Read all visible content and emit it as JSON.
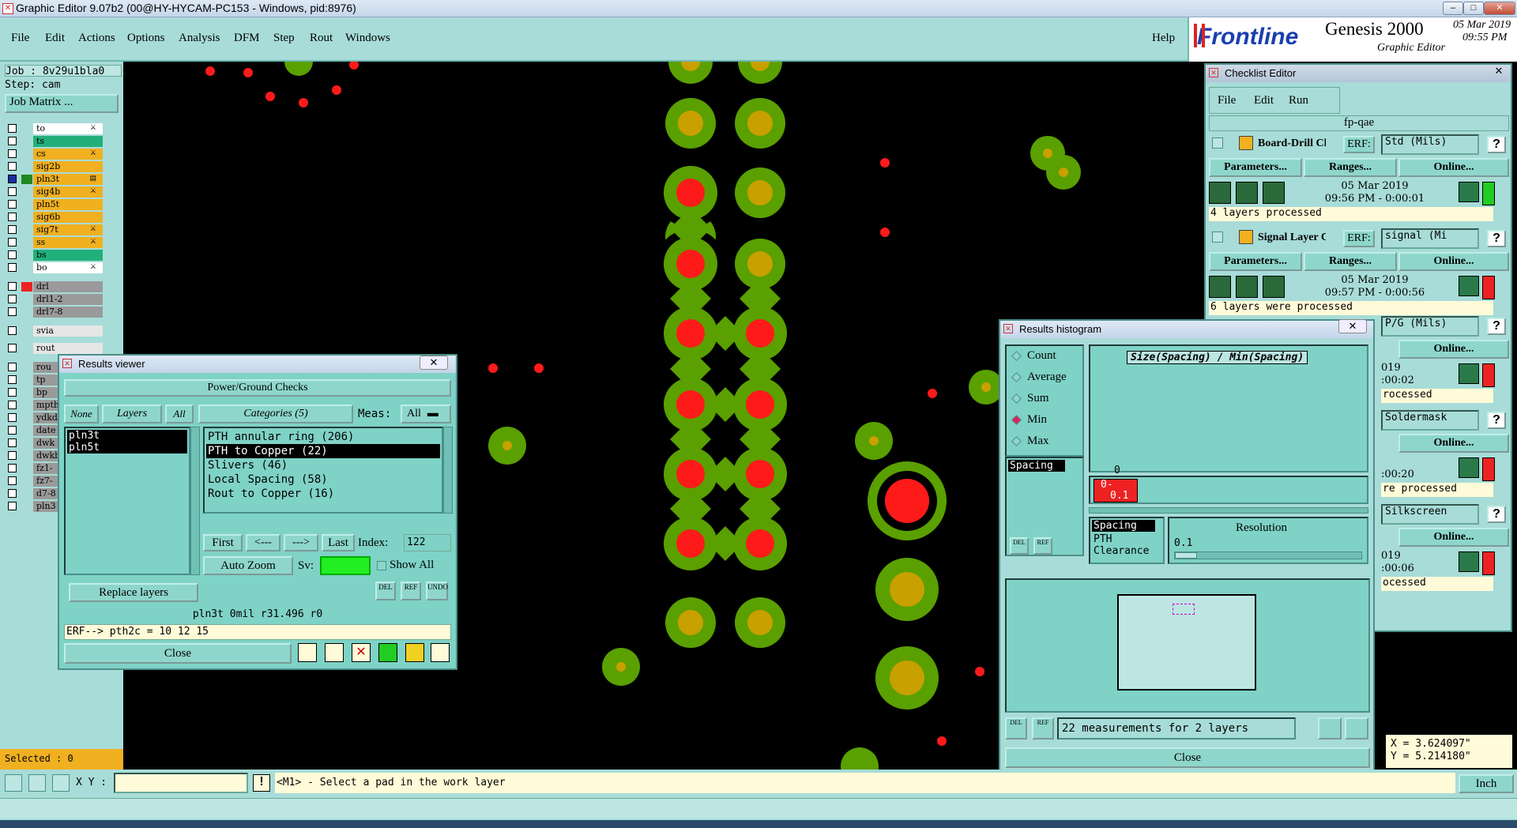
{
  "window": {
    "title": "Graphic Editor 9.07b2 (00@HY-HYCAM-PC153 - Windows, pid:8976)"
  },
  "menu": {
    "items": [
      "File",
      "Edit",
      "Actions",
      "Options",
      "Analysis",
      "DFM",
      "Step",
      "Rout",
      "Windows"
    ],
    "help": "Help"
  },
  "branding": {
    "logo_text": "Frontline",
    "product": "Genesis 2000",
    "subtitle": "Graphic Editor",
    "date": "05 Mar 2019",
    "time": "09:55 PM"
  },
  "left_panel": {
    "job": "Job : 8v29u1bla0",
    "step": "Step: cam",
    "job_matrix_button": "Job Matrix ...",
    "layers": [
      {
        "name": "to",
        "color": "#ffffff",
        "mark": "⚔"
      },
      {
        "name": "ts",
        "color": "#22b07a",
        "mark": ""
      },
      {
        "name": "cs",
        "color": "#f0b020",
        "mark": "⚔"
      },
      {
        "name": "sig2b",
        "color": "#f0b020",
        "mark": ""
      },
      {
        "name": "pln3t",
        "color": "#f0b020",
        "mark": "▤"
      },
      {
        "name": "sig4b",
        "color": "#f0b020",
        "mark": "⚔"
      },
      {
        "name": "pln5t",
        "color": "#f0b020",
        "mark": ""
      },
      {
        "name": "sig6b",
        "color": "#f0b020",
        "mark": ""
      },
      {
        "name": "sig7t",
        "color": "#f0b020",
        "mark": "⚔"
      },
      {
        "name": "ss",
        "color": "#f0b020",
        "mark": "⚔"
      },
      {
        "name": "bs",
        "color": "#22b07a",
        "mark": ""
      },
      {
        "name": "bo",
        "color": "#ffffff",
        "mark": "⚔"
      },
      {
        "name": "drl",
        "color": "#9a9a9a",
        "mark": ""
      },
      {
        "name": "drl1-2",
        "color": "#9a9a9a",
        "mark": ""
      },
      {
        "name": "drl7-8",
        "color": "#9a9a9a",
        "mark": ""
      },
      {
        "name": "svia",
        "color": "#e6e6e6",
        "mark": ""
      },
      {
        "name": "rout",
        "color": "#e6e6e6",
        "mark": ""
      },
      {
        "name": "rou",
        "color": "#9a9a9a",
        "mark": ""
      },
      {
        "name": "tp",
        "color": "#9a9a9a",
        "mark": ""
      },
      {
        "name": "bp",
        "color": "#9a9a9a",
        "mark": ""
      },
      {
        "name": "mpth",
        "color": "#9a9a9a",
        "mark": ""
      },
      {
        "name": "ydkd",
        "color": "#9a9a9a",
        "mark": ""
      },
      {
        "name": "date",
        "color": "#9a9a9a",
        "mark": ""
      },
      {
        "name": "dwk",
        "color": "#9a9a9a",
        "mark": ""
      },
      {
        "name": "dwkb",
        "color": "#9a9a9a",
        "mark": ""
      },
      {
        "name": "fz1-",
        "color": "#9a9a9a",
        "mark": ""
      },
      {
        "name": "fz7-",
        "color": "#9a9a9a",
        "mark": ""
      },
      {
        "name": "d7-8",
        "color": "#9a9a9a",
        "mark": ""
      },
      {
        "name": "pln3",
        "color": "#9a9a9a",
        "mark": ""
      }
    ],
    "selected": "Selected : 0"
  },
  "results_viewer": {
    "title": "Results viewer",
    "header": "Power/Ground Checks",
    "none_btn": "None",
    "layers_btn": "Layers",
    "all_btn": "All",
    "categories_label": "Categories (5)",
    "meas_label": "Meas:",
    "meas_value": "All",
    "layer_list": [
      "pln3t",
      "pln5t"
    ],
    "categories": [
      "PTH annular ring (206)",
      "PTH to Copper (22)",
      "Slivers (46)",
      "Local Spacing (58)",
      "Rout to Copper (16)"
    ],
    "first": "First",
    "prev": "<---",
    "next": "--->",
    "last": "Last",
    "index_label": "Index:",
    "index_value": "122",
    "auto_zoom": "Auto Zoom",
    "sv_label": "Sv:",
    "show_all": "Show All",
    "replace_layers": "Replace layers",
    "del": "DEL",
    "ref": "REF",
    "undo": "UNDO",
    "info_line": "pln3t 0mil  r31.496  r0",
    "erf_line": "ERF--> pth2c = 10 12 15",
    "close": "Close"
  },
  "checklist": {
    "title": "Checklist Editor",
    "menu": [
      "File",
      "Edit",
      "Run"
    ],
    "name": "fp-qae",
    "actions": [
      {
        "name": "Board-Drill Che",
        "erf": "ERF:",
        "erf_value": "Std (Mils)",
        "date": "05 Mar 2019",
        "time": "09:56 PM - 0:00:01",
        "status": "4 layers processed",
        "state": "#22cc22"
      },
      {
        "name": "Signal Layer Ch",
        "erf": "ERF:",
        "erf_value": "signal (Mi",
        "date": "05 Mar 2019",
        "time": "09:57 PM - 0:00:56",
        "status": "6 layers were processed",
        "state": "#ee2222"
      }
    ],
    "partial_rows": [
      {
        "erf_value": "P/G (Mils)",
        "time": "019",
        "elapsed": ":00:02",
        "status": "rocessed"
      },
      {
        "erf_value": "Soldermask",
        "time": "",
        "elapsed": ":00:20",
        "status": "re processed"
      },
      {
        "erf_value": "Silkscreen",
        "time": "019",
        "elapsed": ":00:06",
        "status": "ocessed"
      }
    ],
    "parameters": "Parameters...",
    "ranges": "Ranges...",
    "online": "Online..."
  },
  "histogram": {
    "title": "Results histogram",
    "options": [
      "Count",
      "Average",
      "Sum",
      "Min",
      "Max"
    ],
    "selected_option": "Min",
    "chart_title": "Size(Spacing) / Min(Spacing)",
    "zero_label": "0",
    "bar_label_top": "0-",
    "bar_label_bottom": "0.1",
    "list_item": "Spacing",
    "types": [
      "Spacing",
      "PTH",
      "Clearance"
    ],
    "resolution_label": "Resolution",
    "resolution_value": "0.1",
    "measurements": "22 measurements for 2 layers",
    "close": "Close",
    "del": "DEL",
    "ref": "REF"
  },
  "status": {
    "xy_label": "X Y :",
    "prompt": "<M1> - Select a pad in the work layer",
    "x": "X = 3.624097\"",
    "y": "Y = 5.214180\"",
    "units": "Inch"
  }
}
